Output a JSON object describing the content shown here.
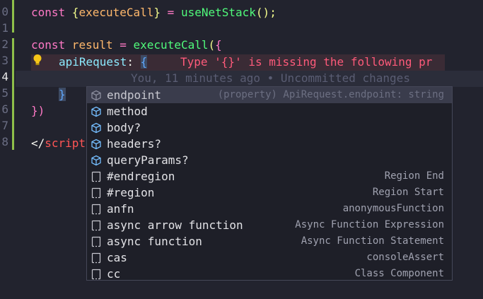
{
  "gutter": [
    "0",
    "1",
    "2",
    "3",
    "4",
    "5",
    "6",
    "7",
    "8"
  ],
  "code": {
    "l0": {
      "kw": "const",
      "open": " {",
      "var": "executeCall",
      "close": "}",
      "eq": " = ",
      "fn": "useNetStack",
      "end": "();"
    },
    "l2": {
      "kw": "const",
      "var": " result",
      "eq": " = ",
      "fn": "executeCall",
      "paren": "(",
      "brace": "{"
    },
    "l3": {
      "prop": "apiRequest",
      "colon": ": ",
      "brace": "{",
      "error": "Type '{}' is missing the following pr"
    },
    "l4": {
      "blame": "You, 11 minutes ago • Uncommitted changes"
    },
    "l5": {
      "brace": "}"
    },
    "l6": {
      "close": "})"
    },
    "l7": {
      "tag_open": "</",
      "tag": "script"
    }
  },
  "suggest": {
    "items": [
      {
        "label": "endpoint",
        "detail": "(property) ApiRequest.endpoint: string",
        "icon": "property-icon",
        "selected": true
      },
      {
        "label": "method",
        "detail": "",
        "icon": "property-icon"
      },
      {
        "label": "body?",
        "detail": "",
        "icon": "property-icon"
      },
      {
        "label": "headers?",
        "detail": "",
        "icon": "property-icon"
      },
      {
        "label": "queryParams?",
        "detail": "",
        "icon": "property-icon"
      },
      {
        "label": "#endregion",
        "detail": "Region End",
        "icon": "snippet-icon"
      },
      {
        "label": "#region",
        "detail": "Region Start",
        "icon": "snippet-icon"
      },
      {
        "label": "anfn",
        "detail": "anonymousFunction",
        "icon": "snippet-icon"
      },
      {
        "label": "async arrow function",
        "detail": "Async Function Expression",
        "icon": "snippet-icon"
      },
      {
        "label": "async function",
        "detail": "Async Function Statement",
        "icon": "snippet-icon"
      },
      {
        "label": "cas",
        "detail": "consoleAssert",
        "icon": "snippet-icon"
      },
      {
        "label": "cc",
        "detail": "Class Component",
        "icon": "snippet-icon"
      }
    ]
  },
  "colors": {
    "background": "#22232e",
    "keyword": "#ff79c6",
    "function": "#50fa7b",
    "variable": "#ffb86c",
    "error": "#ff5a7a",
    "git_added": "#8fbf4a"
  }
}
